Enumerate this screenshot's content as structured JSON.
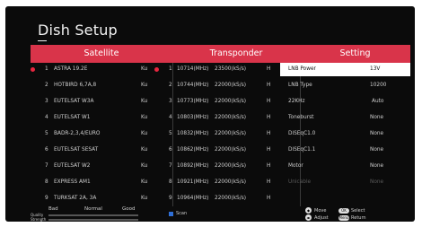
{
  "title": "Dish Setup",
  "headers": {
    "satellite": "Satellite",
    "transponder": "Transponder",
    "setting": "Setting"
  },
  "colors": {
    "accent": "#d9344a",
    "background": "#0b0b0b",
    "selected_row": "#ffffff",
    "scan_key": "#2f6fd6"
  },
  "satellites": [
    {
      "num": "1",
      "name": "ASTRA 19.2E",
      "band": "Ku"
    },
    {
      "num": "2",
      "name": "HOTBIRD 6,7A,8",
      "band": "Ku"
    },
    {
      "num": "3",
      "name": "EUTELSAT W3A",
      "band": "Ku"
    },
    {
      "num": "4",
      "name": "EUTELSAT W1",
      "band": "Ku"
    },
    {
      "num": "5",
      "name": "BADR-2,3,4/EURO",
      "band": "Ku"
    },
    {
      "num": "6",
      "name": "EUTELSAT SESAT",
      "band": "Ku"
    },
    {
      "num": "7",
      "name": "EUTELSAT W2",
      "band": "Ku"
    },
    {
      "num": "8",
      "name": "EXPRESS AM1",
      "band": "Ku"
    },
    {
      "num": "9",
      "name": "TURKSAT 2A, 3A",
      "band": "Ku"
    }
  ],
  "transponders": [
    {
      "num": "1",
      "freq": "10714(MHz)",
      "sr": "23500(kS/s)",
      "pol": "H"
    },
    {
      "num": "2",
      "freq": "10744(MHz)",
      "sr": "22000(kS/s)",
      "pol": "H"
    },
    {
      "num": "3",
      "freq": "10773(MHz)",
      "sr": "22000(kS/s)",
      "pol": "H"
    },
    {
      "num": "4",
      "freq": "10803(MHz)",
      "sr": "22000(kS/s)",
      "pol": "H"
    },
    {
      "num": "5",
      "freq": "10832(MHz)",
      "sr": "22000(kS/s)",
      "pol": "H"
    },
    {
      "num": "6",
      "freq": "10862(MHz)",
      "sr": "22000(kS/s)",
      "pol": "H"
    },
    {
      "num": "7",
      "freq": "10892(MHz)",
      "sr": "22000(kS/s)",
      "pol": "H"
    },
    {
      "num": "8",
      "freq": "10921(MHz)",
      "sr": "22000(kS/s)",
      "pol": "H"
    },
    {
      "num": "9",
      "freq": "10964(MHz)",
      "sr": "22000(kS/s)",
      "pol": "H"
    }
  ],
  "settings": [
    {
      "label": "LNB Power",
      "value": "13V"
    },
    {
      "label": "LNB Type",
      "value": "10200"
    },
    {
      "label": "22KHz",
      "value": "Auto"
    },
    {
      "label": "Toneburst",
      "value": "None"
    },
    {
      "label": "DiSEqC1.0",
      "value": "None"
    },
    {
      "label": "DiSEqC1.1",
      "value": "None"
    },
    {
      "label": "Motor",
      "value": "None"
    },
    {
      "label": "Unicable",
      "value": "None"
    }
  ],
  "footer": {
    "bad": "Bad",
    "normal": "Normal",
    "good": "Good",
    "quality": "Quality",
    "strength": "Strength",
    "scan": "Scan",
    "move": "Move",
    "adjust": "Adjust",
    "ok_key": "OK",
    "select": "Select",
    "menu_key": "Menu",
    "return": "Return"
  }
}
